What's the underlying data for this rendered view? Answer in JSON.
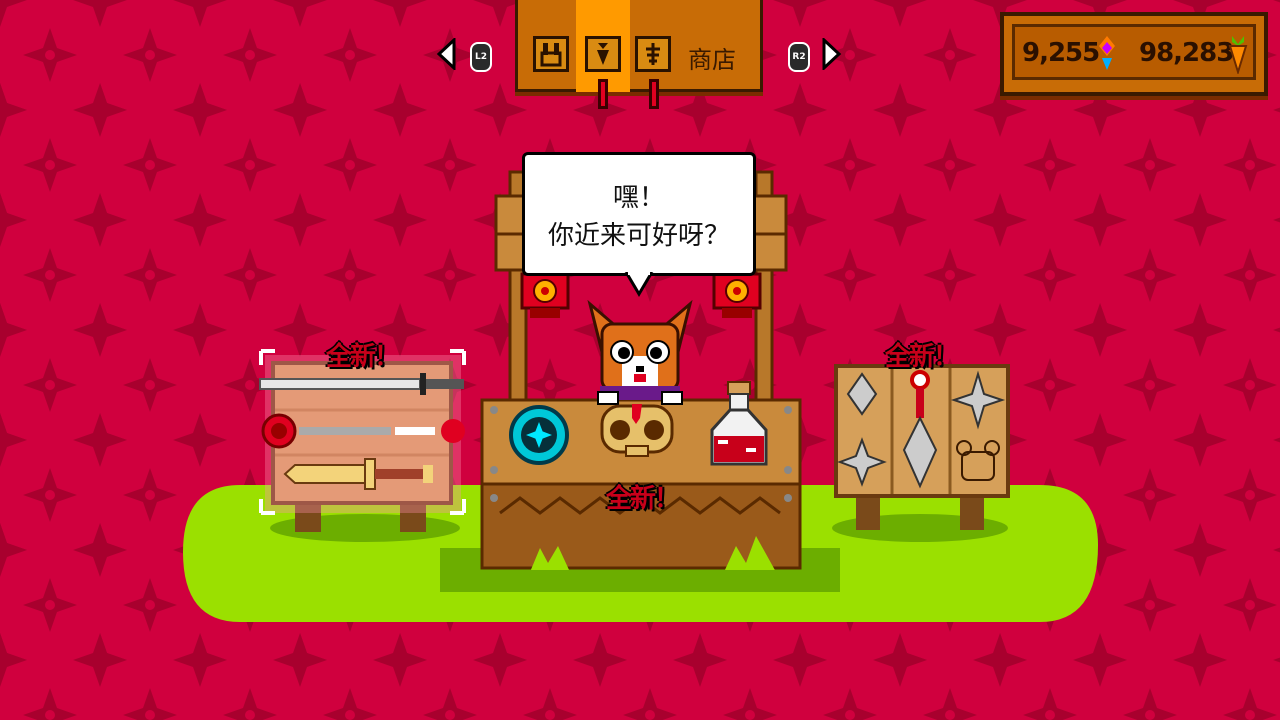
{
  "header": {
    "shop_label": "商店",
    "left_button": "L2",
    "right_button": "R2",
    "tabs": [
      {
        "icon": "bunny-icon"
      },
      {
        "icon": "carrot-icon"
      },
      {
        "icon": "fish-bone-icon"
      }
    ]
  },
  "currency": {
    "gems": "9,255",
    "carrots": "98,283"
  },
  "dialog": {
    "line1": "嘿！",
    "line2": "你近来可好呀？"
  },
  "stalls": {
    "left_badge": "全新！",
    "center_badge": "全新！",
    "right_badge": "全新！"
  },
  "colors": {
    "background": "#d0003e",
    "accent": "#ff9a00",
    "grass": "#9be000",
    "wood": "#c98a3c"
  }
}
